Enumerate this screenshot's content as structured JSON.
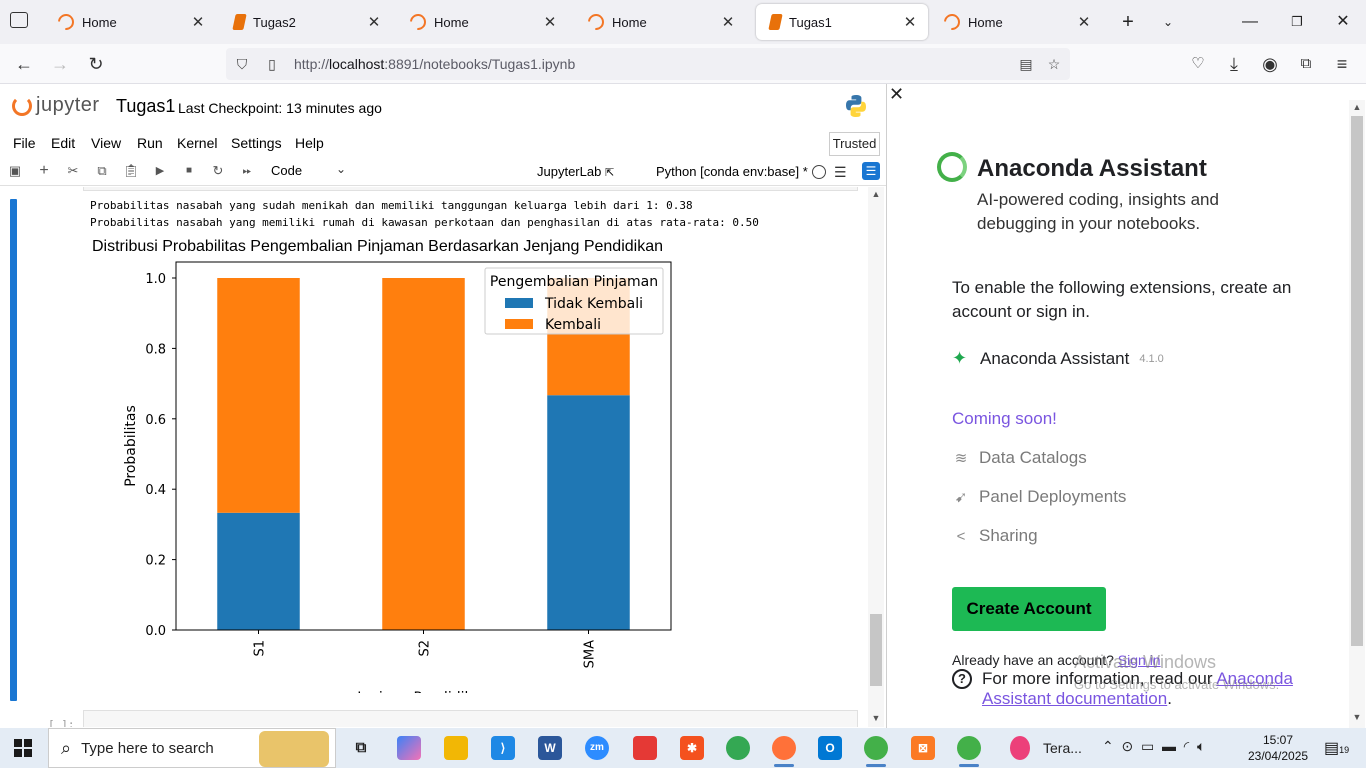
{
  "browser": {
    "tabs": [
      {
        "label": "Home",
        "icon": "jupyter-icon"
      },
      {
        "label": "Tugas2",
        "icon": "notebook-icon"
      },
      {
        "label": "Home",
        "icon": "jupyter-icon"
      },
      {
        "label": "Home",
        "icon": "jupyter-icon"
      },
      {
        "label": "Tugas1",
        "icon": "notebook-icon",
        "active": true
      },
      {
        "label": "Home",
        "icon": "jupyter-icon"
      }
    ],
    "url_prefix": "http://",
    "url_host": "localhost",
    "url_rest": ":8891/notebooks/Tugas1.ipynb"
  },
  "jupyter": {
    "logo": "jupyter",
    "notebook_name": "Tugas1",
    "checkpoint": "Last Checkpoint: 13 minutes ago",
    "menu": [
      "File",
      "Edit",
      "View",
      "Run",
      "Kernel",
      "Settings",
      "Help"
    ],
    "trusted": "Trusted",
    "cell_type": "Code",
    "jupyterlab_label": "JupyterLab",
    "kernel": "Python [conda env:base] *",
    "output_lines": [
      "Probabilitas nasabah yang sudah menikah dan memiliki tanggungan keluarga lebih dari 1: 0.38",
      "Probabilitas nasabah yang memiliki rumah di kawasan perkotaan dan penghasilan di atas rata-rata: 0.50"
    ],
    "next_cell_prompt": "[ ]:"
  },
  "chart_data": {
    "type": "bar",
    "stacked": true,
    "title": "Distribusi Probabilitas Pengembalian Pinjaman Berdasarkan Jenjang Pendidikan",
    "xlabel": "Jenjang Pendidikan",
    "ylabel": "Probabilitas",
    "categories": [
      "S1",
      "S2",
      "SMA"
    ],
    "ylim": [
      0,
      1.0
    ],
    "yticks": [
      "0.0",
      "0.2",
      "0.4",
      "0.6",
      "0.8",
      "1.0"
    ],
    "legend_title": "Pengembalian Pinjaman",
    "legend_position": "top-right",
    "series": [
      {
        "name": "Tidak Kembali",
        "color": "#1f77b4",
        "values": [
          0.333,
          0.0,
          0.667
        ]
      },
      {
        "name": "Kembali",
        "color": "#ff7f0e",
        "values": [
          0.667,
          1.0,
          0.333
        ]
      }
    ]
  },
  "anaconda": {
    "title": "Anaconda Assistant",
    "subtitle": "AI-powered coding, insights and debugging in your notebooks.",
    "enable_text": "To enable the following extensions, create an account or sign in.",
    "extension_name": "Anaconda Assistant",
    "extension_version": "4.1.0",
    "coming_soon": "Coming soon!",
    "features": [
      "Data Catalogs",
      "Panel Deployments",
      "Sharing"
    ],
    "create_account": "Create Account",
    "already": "Already have an account?",
    "sign_in": "Sign in",
    "info_prefix": "For more information, read our",
    "info_link": "Anaconda Assistant documentation",
    "info_suffix": ".",
    "accent_color": "#7a55e0",
    "button_color": "#1db954"
  },
  "watermark": {
    "line1": "Activate Windows",
    "line2": "Go to Settings to activate Windows."
  },
  "taskbar": {
    "search_placeholder": "Type here to search",
    "running_app_label": "Tera...",
    "time": "15:07",
    "date": "23/04/2025",
    "notification_count": "19"
  }
}
